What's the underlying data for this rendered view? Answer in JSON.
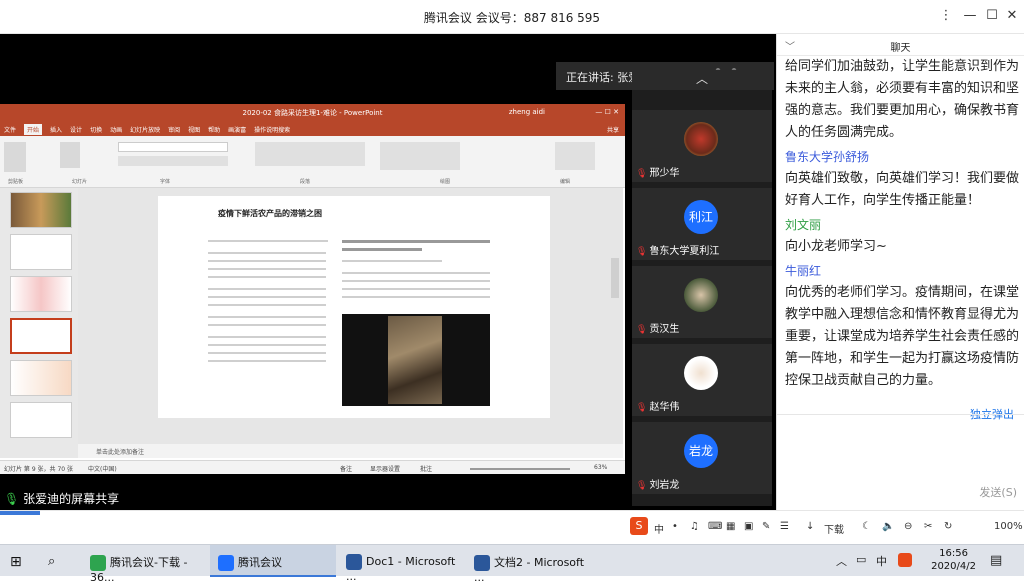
{
  "window": {
    "title": "腾讯会议 会议号：887 816 595",
    "min_glyph": "—",
    "max_glyph": "☐",
    "close_glyph": "✕"
  },
  "speaking": "正在讲话: 张爱迪;",
  "ppt": {
    "title": "2020-02 食路采访生理1-难论 - PowerPoint",
    "user": "zheng aidi",
    "share_label": "共享",
    "tabs": [
      "文件",
      "开始",
      "插入",
      "设计",
      "切换",
      "动画",
      "幻灯片放映",
      "审阅",
      "视图",
      "帮助",
      "画演富",
      "操作说明搜索"
    ],
    "ribbon_groups": [
      "剪贴板",
      "幻灯片",
      "字体",
      "段落",
      "绘图",
      "编辑"
    ],
    "slide_title": "疫情下鲜活农产品的滞销之困",
    "notes_placeholder": "单击此处添加备注",
    "status_left": "幻灯片 第 9 张，共 70 张",
    "status_lang": "中文(中国)",
    "status_notes": "备注",
    "status_display": "显示器设置",
    "status_comments": "批注",
    "zoom": "63%"
  },
  "gallery": {
    "participants": [
      {
        "name": "邢少华",
        "avatar": "",
        "color": "#c0392b"
      },
      {
        "name": "鲁东大学夏利江",
        "avatar": "利江",
        "color": "#1e6fff"
      },
      {
        "name": "贡汉生",
        "avatar": "",
        "color": "#6b7a5a"
      },
      {
        "name": "赵华伟",
        "avatar": "",
        "color": "#e8e8e8"
      },
      {
        "name": "刘岩龙",
        "avatar": "岩龙",
        "color": "#1e6fff"
      }
    ]
  },
  "share_status": "张爱迪的屏幕共享",
  "chat": {
    "header": "聊天",
    "messages": [
      {
        "sender": "",
        "color": "",
        "text": "给同学们加油鼓劲，让学生能意识到作为未来的主人翁，必须要有丰富的知识和坚强的意志。我们要更加用心，确保教书育人的任务圆满完成。"
      },
      {
        "sender": "鲁东大学孙舒扬",
        "color": "#3b5bdb",
        "text": "向英雄们致敬，向英雄们学习！我们要做好育人工作，向学生传播正能量！"
      },
      {
        "sender": "刘文丽",
        "color": "#2f9e44",
        "text": "向小龙老师学习~"
      },
      {
        "sender": "牛丽红",
        "color": "#3b5bdb",
        "text": "向优秀的老师们学习。疫情期间，在课堂教学中融入理想信念和情怀教育显得尤为重要，让课堂成为培养学生社会责任感的第一阵地，和学生一起为打赢这场疫情防控保卫战贡献自己的力量。"
      }
    ],
    "popout": "独立弹出",
    "send": "发送(S)"
  },
  "strip": {
    "ime_items": [
      "中",
      "•",
      "♫",
      "⌨",
      "▦",
      "▣",
      "✎",
      "☰"
    ],
    "download": "下载",
    "zoom": "100%"
  },
  "taskbar": {
    "apps": [
      {
        "label": "腾讯会议-下载 - 36...",
        "color": "#2ea44f",
        "active": false
      },
      {
        "label": "腾讯会议",
        "color": "#1e6fff",
        "active": true
      },
      {
        "label": "Doc1 - Microsoft ...",
        "color": "#2b579a",
        "active": false
      },
      {
        "label": "文档2 - Microsoft ...",
        "color": "#2b579a",
        "active": false
      }
    ],
    "ime": "中",
    "time": "16:56",
    "date": "2020/4/2"
  }
}
